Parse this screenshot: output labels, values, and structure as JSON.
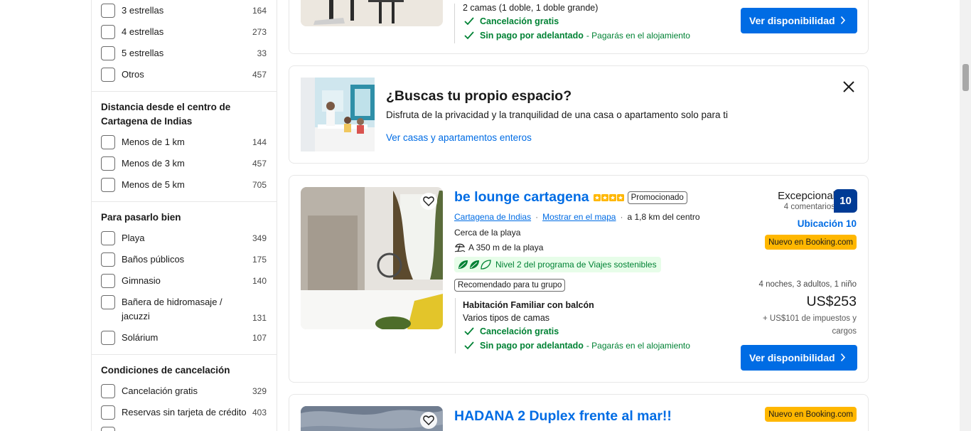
{
  "sidebar": {
    "stars": [
      {
        "label": "3 estrellas",
        "count": "164"
      },
      {
        "label": "4 estrellas",
        "count": "273"
      },
      {
        "label": "5 estrellas",
        "count": "33"
      },
      {
        "label": "Otros",
        "count": "457"
      }
    ],
    "distance": {
      "title": "Distancia desde el centro de Cartagena de Indias",
      "items": [
        {
          "label": "Menos de 1 km",
          "count": "144"
        },
        {
          "label": "Menos de 3 km",
          "count": "457"
        },
        {
          "label": "Menos de 5 km",
          "count": "705"
        }
      ]
    },
    "fun": {
      "title": "Para pasarlo bien",
      "items": [
        {
          "label": "Playa",
          "count": "349"
        },
        {
          "label": "Baños públicos",
          "count": "175"
        },
        {
          "label": "Gimnasio",
          "count": "140"
        },
        {
          "label": "Bañera de hidromasaje / jacuzzi",
          "count": "131"
        },
        {
          "label": "Solárium",
          "count": "107"
        }
      ]
    },
    "cancel": {
      "title": "Condiciones de cancelación",
      "items": [
        {
          "label": "Cancelación gratis",
          "count": "329"
        },
        {
          "label": "Reservas sin tarjeta de crédito",
          "count": "403"
        }
      ]
    }
  },
  "card1": {
    "beds": "2 camas (1 doble, 1 doble grande)",
    "free_cancel": "Cancelación gratis",
    "no_prepay": "Sin pago por adelantado",
    "pay_at_property": "- Pagarás en el alojamiento",
    "cta": "Ver disponibilidad"
  },
  "promo": {
    "title": "¿Buscas tu propio espacio?",
    "subtitle": "Disfruta de la privacidad y la tranquilidad de una casa o apartamento solo para ti",
    "link": "Ver casas y apartamentos enteros"
  },
  "card2": {
    "name": "be lounge cartagena",
    "stars": 4,
    "promoted": "Promocionado",
    "city_link": "Cartagena de Indias",
    "map_link": "Mostrar en el mapa",
    "distance": "a 1,8 km del centro",
    "near_beach": "Cerca de la playa",
    "beach_distance": "A 350 m de la playa",
    "sustainable": "Nivel 2 del programa de Viajes sostenibles",
    "group_badge": "Recomendado para tu grupo",
    "room_name": "Habitación Familiar con balcón",
    "bed_types": "Varios tipos de camas",
    "free_cancel": "Cancelación gratis",
    "no_prepay": "Sin pago por adelantado",
    "pay_at_property": "- Pagarás en el alojamiento",
    "rating_word": "Excepcional",
    "reviews": "4 comentarios",
    "score": "10",
    "location_score": "Ubicación 10",
    "new_badge": "Nuevo en Booking.com",
    "stay_info": "4 noches, 3 adultos, 1 niño",
    "price": "US$253",
    "taxes": "+ US$101 de impuestos y cargos",
    "cta": "Ver disponibilidad"
  },
  "card3": {
    "name": "HADANA 2 Duplex frente al mar!!",
    "new_badge": "Nuevo en Booking.com"
  },
  "colors": {
    "primary": "#006ce4",
    "score_bg": "#003b95",
    "green": "#008234",
    "star": "#ffb700",
    "new_badge_bg": "#ffb700"
  }
}
